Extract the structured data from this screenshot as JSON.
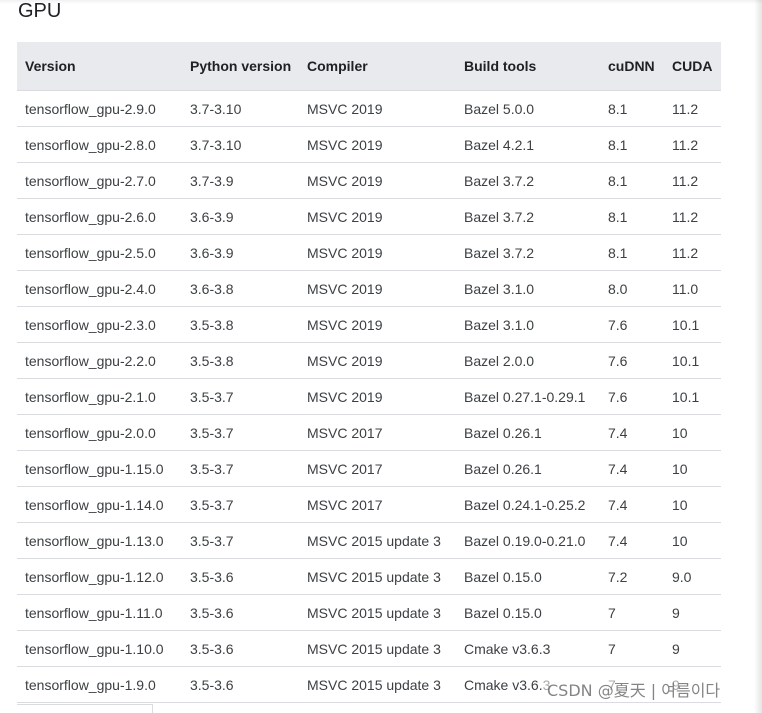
{
  "heading": "GPU",
  "table": {
    "headers": [
      "Version",
      "Python version",
      "Compiler",
      "Build tools",
      "cuDNN",
      "CUDA"
    ],
    "rows": [
      [
        "tensorflow_gpu-2.9.0",
        "3.7-3.10",
        "MSVC 2019",
        "Bazel 5.0.0",
        "8.1",
        "11.2"
      ],
      [
        "tensorflow_gpu-2.8.0",
        "3.7-3.10",
        "MSVC 2019",
        "Bazel 4.2.1",
        "8.1",
        "11.2"
      ],
      [
        "tensorflow_gpu-2.7.0",
        "3.7-3.9",
        "MSVC 2019",
        "Bazel 3.7.2",
        "8.1",
        "11.2"
      ],
      [
        "tensorflow_gpu-2.6.0",
        "3.6-3.9",
        "MSVC 2019",
        "Bazel 3.7.2",
        "8.1",
        "11.2"
      ],
      [
        "tensorflow_gpu-2.5.0",
        "3.6-3.9",
        "MSVC 2019",
        "Bazel 3.7.2",
        "8.1",
        "11.2"
      ],
      [
        "tensorflow_gpu-2.4.0",
        "3.6-3.8",
        "MSVC 2019",
        "Bazel 3.1.0",
        "8.0",
        "11.0"
      ],
      [
        "tensorflow_gpu-2.3.0",
        "3.5-3.8",
        "MSVC 2019",
        "Bazel 3.1.0",
        "7.6",
        "10.1"
      ],
      [
        "tensorflow_gpu-2.2.0",
        "3.5-3.8",
        "MSVC 2019",
        "Bazel 2.0.0",
        "7.6",
        "10.1"
      ],
      [
        "tensorflow_gpu-2.1.0",
        "3.5-3.7",
        "MSVC 2019",
        "Bazel 0.27.1-0.29.1",
        "7.6",
        "10.1"
      ],
      [
        "tensorflow_gpu-2.0.0",
        "3.5-3.7",
        "MSVC 2017",
        "Bazel 0.26.1",
        "7.4",
        "10"
      ],
      [
        "tensorflow_gpu-1.15.0",
        "3.5-3.7",
        "MSVC 2017",
        "Bazel 0.26.1",
        "7.4",
        "10"
      ],
      [
        "tensorflow_gpu-1.14.0",
        "3.5-3.7",
        "MSVC 2017",
        "Bazel 0.24.1-0.25.2",
        "7.4",
        "10"
      ],
      [
        "tensorflow_gpu-1.13.0",
        "3.5-3.7",
        "MSVC 2015 update 3",
        "Bazel 0.19.0-0.21.0",
        "7.4",
        "10"
      ],
      [
        "tensorflow_gpu-1.12.0",
        "3.5-3.6",
        "MSVC 2015 update 3",
        "Bazel 0.15.0",
        "7.2",
        "9.0"
      ],
      [
        "tensorflow_gpu-1.11.0",
        "3.5-3.6",
        "MSVC 2015 update 3",
        "Bazel 0.15.0",
        "7",
        "9"
      ],
      [
        "tensorflow_gpu-1.10.0",
        "3.5-3.6",
        "MSVC 2015 update 3",
        "Cmake v3.6.3",
        "7",
        "9"
      ],
      [
        "tensorflow_gpu-1.9.0",
        "3.5-3.6",
        "MSVC 2015 update 3",
        "Cmake v3.6.3",
        "7",
        "9"
      ]
    ]
  },
  "watermark": "CSDN @夏天 | 여름이다"
}
